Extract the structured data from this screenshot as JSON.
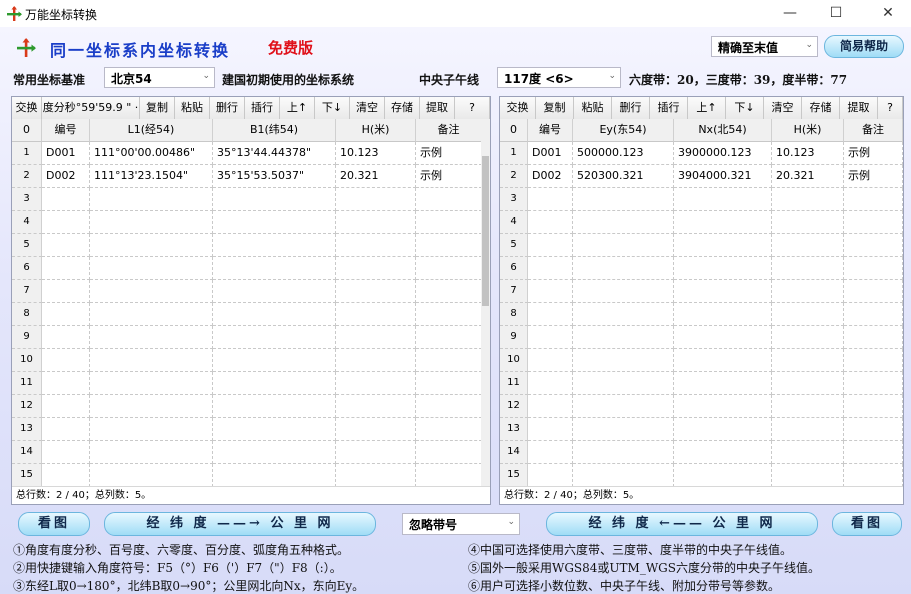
{
  "window": {
    "title": "万能坐标转换",
    "minimize": "—",
    "maximize": "☐",
    "close": "✕"
  },
  "header": {
    "title": "同一坐标系内坐标转换",
    "badge": "免费版",
    "precision": "精确至末值",
    "help_label": "简易帮助"
  },
  "datum": {
    "label": "常用坐标基准",
    "value": "北京54",
    "description": "建国初期使用的坐标系统",
    "meridian_label": "中央子午线",
    "meridian_value": "117度 <6>",
    "zone_info": "六度带：20，三度带：39，度半带：77"
  },
  "left_panel": {
    "toolbar": [
      "交换",
      "度分秒°59'59.9 \" ·",
      "复制",
      "粘贴",
      "删行",
      "插行",
      "上↑",
      "下↓",
      "清空",
      "存储",
      "提取",
      "?"
    ],
    "columns": [
      "0",
      "编号",
      "L1(经54)",
      "B1(纬54)",
      "H(米)",
      "备注"
    ],
    "rows": [
      [
        "1",
        "D001",
        "111°00'00.00486\"",
        "35°13'44.44378\"",
        "10.123",
        "示例"
      ],
      [
        "2",
        "D002",
        "111°13'23.1504\"",
        "35°15'53.5037\"",
        "20.321",
        "示例"
      ],
      [
        "3",
        "",
        "",
        "",
        "",
        ""
      ],
      [
        "4",
        "",
        "",
        "",
        "",
        ""
      ],
      [
        "5",
        "",
        "",
        "",
        "",
        ""
      ],
      [
        "6",
        "",
        "",
        "",
        "",
        ""
      ],
      [
        "7",
        "",
        "",
        "",
        "",
        ""
      ],
      [
        "8",
        "",
        "",
        "",
        "",
        ""
      ],
      [
        "9",
        "",
        "",
        "",
        "",
        ""
      ],
      [
        "10",
        "",
        "",
        "",
        "",
        ""
      ],
      [
        "11",
        "",
        "",
        "",
        "",
        ""
      ],
      [
        "12",
        "",
        "",
        "",
        "",
        ""
      ],
      [
        "13",
        "",
        "",
        "",
        "",
        ""
      ],
      [
        "14",
        "",
        "",
        "",
        "",
        ""
      ],
      [
        "15",
        "",
        "",
        "",
        "",
        ""
      ]
    ],
    "status": "总行数：2 / 40；总列数：5。"
  },
  "right_panel": {
    "toolbar": [
      "交换",
      "复制",
      "粘贴",
      "删行",
      "插行",
      "上↑",
      "下↓",
      "清空",
      "存储",
      "提取",
      "?"
    ],
    "columns": [
      "0",
      "编号",
      "Ey(东54)",
      "Nx(北54)",
      "H(米)",
      "备注"
    ],
    "rows": [
      [
        "1",
        "D001",
        "500000.123",
        "3900000.123",
        "10.123",
        "示例"
      ],
      [
        "2",
        "D002",
        "520300.321",
        "3904000.321",
        "20.321",
        "示例"
      ],
      [
        "3",
        "",
        "",
        "",
        "",
        ""
      ],
      [
        "4",
        "",
        "",
        "",
        "",
        ""
      ],
      [
        "5",
        "",
        "",
        "",
        "",
        ""
      ],
      [
        "6",
        "",
        "",
        "",
        "",
        ""
      ],
      [
        "7",
        "",
        "",
        "",
        "",
        ""
      ],
      [
        "8",
        "",
        "",
        "",
        "",
        ""
      ],
      [
        "9",
        "",
        "",
        "",
        "",
        ""
      ],
      [
        "10",
        "",
        "",
        "",
        "",
        ""
      ],
      [
        "11",
        "",
        "",
        "",
        "",
        ""
      ],
      [
        "12",
        "",
        "",
        "",
        "",
        ""
      ],
      [
        "13",
        "",
        "",
        "",
        "",
        ""
      ],
      [
        "14",
        "",
        "",
        "",
        "",
        ""
      ],
      [
        "15",
        "",
        "",
        "",
        "",
        ""
      ]
    ],
    "status": "总行数：2 / 40；总列数：5。"
  },
  "actions": {
    "view_map_left": "看图",
    "to_grid": "经 纬 度 ——→ 公 里 网",
    "ignore_zone": "忽略带号",
    "to_latlon": "经 纬 度 ←—— 公 里 网",
    "view_map_right": "看图"
  },
  "notes": [
    "①角度有度分秒、百号度、六零度、百分度、弧度角五种格式。",
    "②用快捷键输入角度符号：F5（°）F6（'）F7（\"）F8（:）。",
    "③东经L取0→180°，北纬B取0→90°；公里网北向Nx，东向Ey。",
    "④中国可选择使用六度带、三度带、度半带的中央子午线值。",
    "⑤国外一般采用WGS84或UTM_WGS六度分带的中央子午线值。",
    "⑥用户可选择小数位数、中央子午线、附加分带号等参数。"
  ],
  "icons": {
    "app": "cross-arrows-icon",
    "headline": "cross-arrows-icon",
    "dropdown": "chevron-down-icon"
  },
  "colors": {
    "title_blue": "#1a3ec8",
    "free_red": "#e0101a",
    "pill_blue": "#9fdcf6"
  }
}
